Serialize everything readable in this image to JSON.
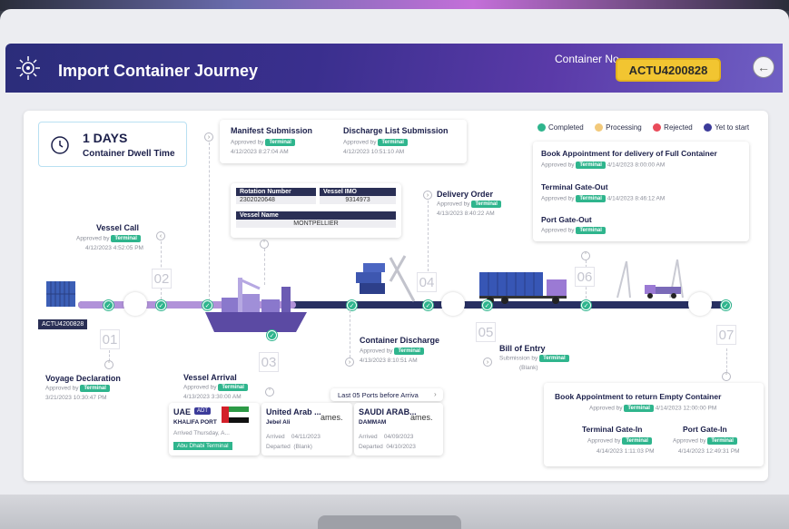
{
  "header": {
    "title": "Import Container Journey",
    "container_label": "Container No",
    "container_no": "ACTU4200828"
  },
  "dwell": {
    "days": "1 DAYS",
    "label": "Container Dwell Time"
  },
  "legend": [
    {
      "label": "Completed",
      "color": "#2fb58d"
    },
    {
      "label": "Processing",
      "color": "#f2c97a"
    },
    {
      "label": "Rejected",
      "color": "#e94b5a"
    },
    {
      "label": "Yet to start",
      "color": "#3c3b9a"
    }
  ],
  "approved_by": "Approved by",
  "submission_by": "Submission by",
  "terminal": "Terminal",
  "manifest": {
    "title": "Manifest Submission",
    "date": "4/12/2023 8:27:04 AM"
  },
  "discharge_list": {
    "title": "Discharge List Submission",
    "date": "4/12/2023 10:51:10 AM"
  },
  "vessel_info": {
    "rotation_label": "Rotation Number",
    "rotation_value": "2302020648",
    "imo_label": "Vessel IMO",
    "imo_value": "9314973",
    "name_label": "Vessel Name",
    "name_value": "MONTPELLIER"
  },
  "vessel_call": {
    "title": "Vessel Call",
    "date": "4/12/2023 4:52:05 PM"
  },
  "delivery_order": {
    "title": "Delivery Order",
    "date": "4/13/2023 8:40:22 AM"
  },
  "book_full": {
    "title": "Book Appointment for delivery of Full Container",
    "date": "4/14/2023 8:00:00 AM"
  },
  "gate_out": {
    "title": "Terminal Gate-Out",
    "date": "4/14/2023 8:46:12 AM"
  },
  "port_gate_out": {
    "title": "Port Gate-Out"
  },
  "container_tag": "ACTU4200828",
  "steps": [
    "01",
    "02",
    "03",
    "04",
    "05",
    "06",
    "07"
  ],
  "voyage": {
    "title": "Voyage Declaration",
    "date": "3/21/2023 10:30:47 PM"
  },
  "vessel_arrival": {
    "title": "Vessel Arrival",
    "date": "4/13/2023 3:30:00 AM"
  },
  "container_discharge": {
    "title": "Container Discharge",
    "date": "4/13/2023 8:10:51 AM"
  },
  "bill_of_entry": {
    "title": "Bill of Entry",
    "status": "(Blank)"
  },
  "ports_header": "Last 05 Ports before Arriva",
  "ports": [
    {
      "country": "UAE",
      "tag": "ADT",
      "port": "KHALIFA PORT",
      "arrived": "Arrived Thursday, A...",
      "terminal": "Abu Dhabi Terminal"
    },
    {
      "country": "United Arab ...",
      "port": "Jebel Ali",
      "overflow": "ames.",
      "arrived_label": "Arrived",
      "arrived": "04/11/2023",
      "departed_label": "Departed",
      "departed": "(Blank)"
    },
    {
      "country": "SAUDI ARAB...",
      "port": "DAMMAM",
      "overflow": "ames.",
      "arrived_label": "Arrived",
      "arrived": "04/09/2023",
      "departed_label": "Departed",
      "departed": "04/10/2023"
    }
  ],
  "book_empty": {
    "title": "Book Appointment to return Empty Container",
    "date": "4/14/2023 12:00:00 PM"
  },
  "gate_in": {
    "title": "Terminal Gate-In",
    "date": "4/14/2023 1:11:03 PM"
  },
  "port_gate_in": {
    "title": "Port Gate-In",
    "date": "4/14/2023 12:49:31 PM"
  }
}
